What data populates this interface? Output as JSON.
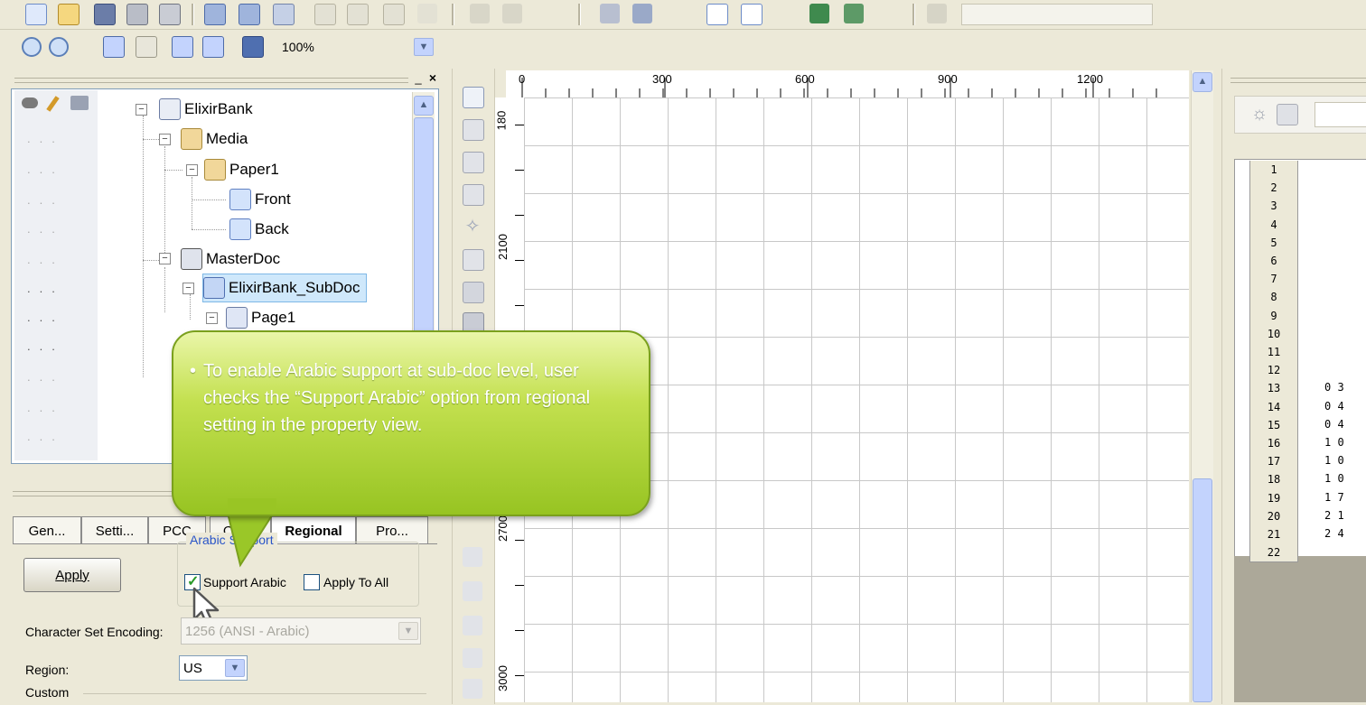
{
  "toolbar": {
    "zoom_value": "100%",
    "row1_icons": [
      "new-icon",
      "open-icon",
      "save-icon",
      "print-icon",
      "printer-setup-icon",
      "cut-icon",
      "copy-icon",
      "paste-icon",
      "undo-icon",
      "redo-icon"
    ],
    "row2_icons": [
      "zoom-in-icon",
      "zoom-out-icon",
      "zoom-fit-icon",
      "zoom-page-icon",
      "zoom-width-icon",
      "zoom-selection-icon",
      "actual-size-icon"
    ]
  },
  "tree": {
    "column_icons": [
      "eye-icon",
      "pencil-icon",
      "printer-icon"
    ],
    "items": [
      {
        "label": "ElixirBank"
      },
      {
        "label": "Media"
      },
      {
        "label": "Paper1"
      },
      {
        "label": "Front"
      },
      {
        "label": "Back"
      },
      {
        "label": "MasterDoc"
      },
      {
        "label": "ElixirBank_SubDoc"
      },
      {
        "label": "Page1"
      }
    ]
  },
  "tabs": [
    "Gen...",
    "Setti...",
    "PCC",
    "Cyc...",
    "Regional",
    "Pro..."
  ],
  "properties": {
    "apply_button": "Apply",
    "arabic_support_group": "Arabic Support",
    "support_arabic_label": "Support Arabic",
    "support_arabic_checked": true,
    "apply_to_all_label": "Apply To All",
    "apply_to_all_checked": false,
    "charset_label": "Character Set Encoding:",
    "charset_value": "1256 (ANSI - Arabic)",
    "region_label": "Region:",
    "region_value": "US",
    "custom_label": "Custom"
  },
  "ruler": {
    "h_labels": [
      "0",
      "300",
      "600",
      "900",
      "1200"
    ],
    "v_labels": [
      "180",
      "2100",
      "2700",
      "3000"
    ]
  },
  "grid": {
    "row_numbers": [
      "1",
      "2",
      "3",
      "4",
      "5",
      "6",
      "7",
      "8",
      "9",
      "10",
      "11",
      "12",
      "13",
      "14",
      "15",
      "16",
      "17",
      "18",
      "19",
      "20",
      "21",
      "22"
    ],
    "cell_values": [
      "0 3",
      "0 4",
      "0 4",
      "1 0",
      "1 0",
      "1 0",
      "1 7",
      "2 1",
      "2 4"
    ]
  },
  "callout": {
    "text": "To enable Arabic support at sub-doc level, user checks the “Support Arabic” option from regional setting in the property view."
  },
  "colors": {
    "accent": "#c3d3fd",
    "callout_green": "#9ac728",
    "selection": "#cfe8fb"
  }
}
